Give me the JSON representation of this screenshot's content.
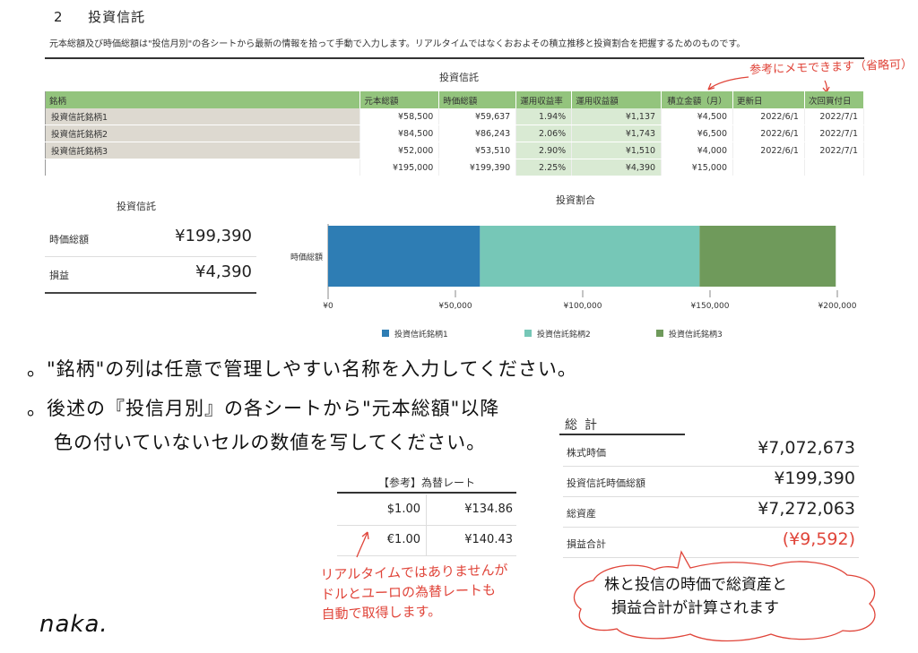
{
  "section": {
    "number": "2",
    "title": "投資信託"
  },
  "description": "元本総額及び時価総額は\"投信月別\"の各シートから最新の情報を拾って手動で入力します。リアルタイムではなくおおよその積立推移と投資割合を把握するためのものです。",
  "table": {
    "title": "投資信託",
    "headers": [
      "銘柄",
      "元本総額",
      "時価総額",
      "運用収益率",
      "運用収益額",
      "積立金額（月）",
      "更新日",
      "次回買付日"
    ],
    "rows": [
      [
        "投資信託銘柄1",
        "¥58,500",
        "¥59,637",
        "1.94%",
        "¥1,137",
        "¥4,500",
        "2022/6/1",
        "2022/7/1"
      ],
      [
        "投資信託銘柄2",
        "¥84,500",
        "¥86,243",
        "2.06%",
        "¥1,743",
        "¥6,500",
        "2022/6/1",
        "2022/7/1"
      ],
      [
        "投資信託銘柄3",
        "¥52,000",
        "¥53,510",
        "2.90%",
        "¥1,510",
        "¥4,000",
        "2022/6/1",
        "2022/7/1"
      ]
    ],
    "total": [
      "",
      "¥195,000",
      "¥199,390",
      "2.25%",
      "¥4,390",
      "¥15,000",
      "",
      ""
    ]
  },
  "summary": {
    "title": "投資信託",
    "rows": [
      {
        "label": "時価総額",
        "value": "¥199,390"
      },
      {
        "label": "損益",
        "value": "¥4,390"
      }
    ]
  },
  "chart_data": {
    "type": "bar",
    "orientation": "horizontal-stacked",
    "title": "投資割合",
    "categories": [
      "時価総額"
    ],
    "series": [
      {
        "name": "投資信託銘柄1",
        "values": [
          59637
        ],
        "color": "#2e7db4"
      },
      {
        "name": "投資信託銘柄2",
        "values": [
          86243
        ],
        "color": "#76c7b7"
      },
      {
        "name": "投資信託銘柄3",
        "values": [
          53510
        ],
        "color": "#6f9a5b"
      }
    ],
    "xlim": [
      0,
      200000
    ],
    "x_ticks": [
      "¥0",
      "¥50,000",
      "¥100,000",
      "¥150,000",
      "¥200,000"
    ],
    "legend": "bottom",
    "grid": false
  },
  "notes": {
    "memo_top": "参考にメモできます（省略可）",
    "line1": "。\"銘柄\"の列は任意で管理しやすい名称を入力してください。",
    "line2": "。後述の『投信月別』の各シートから\"元本総額\"以降",
    "line3": "色の付いていないセルの数値を写してください。",
    "red_note": [
      "リアルタイムではありませんが",
      "ドルとユーロの為替レートも",
      "自動で取得します。"
    ],
    "bubble": [
      "株と投信の時価で総資産と",
      "損益合計が計算されます"
    ],
    "signature": "naka."
  },
  "totals": {
    "title": "総計",
    "rows": [
      {
        "label": "株式時価",
        "value": "¥7,072,673"
      },
      {
        "label": "投資信託時価総額",
        "value": "¥199,390"
      },
      {
        "label": "総資産",
        "value": "¥7,272,063"
      },
      {
        "label": "損益合計",
        "value": "(¥9,592)"
      }
    ]
  },
  "fx": {
    "title": "【参考】為替レート",
    "rows": [
      {
        "currency": "$1.00",
        "rate": "¥134.86"
      },
      {
        "currency": "€1.00",
        "rate": "¥140.43"
      }
    ]
  },
  "colors": {
    "header_green": "#93c47d",
    "light_green": "#d9ead3",
    "name_gray": "#ddd9d0",
    "red": "#e0453a"
  }
}
